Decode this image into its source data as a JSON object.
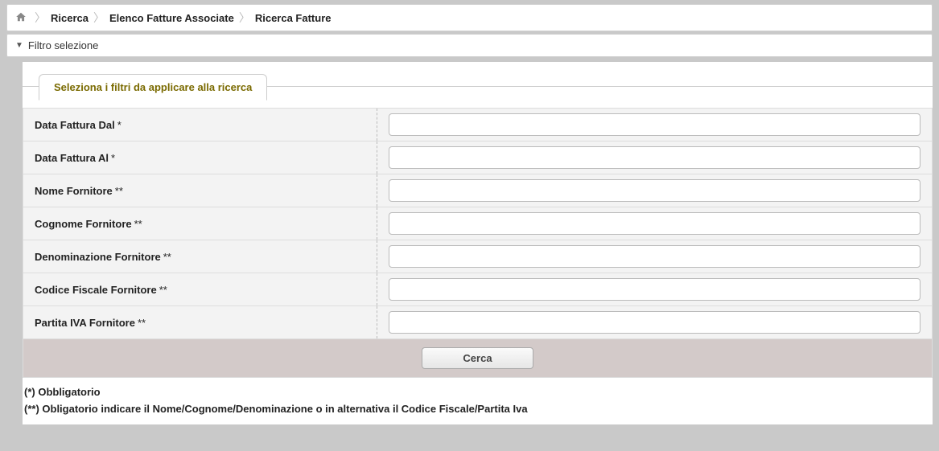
{
  "breadcrumb": {
    "item1": "Ricerca",
    "item2": "Elenco Fatture Associate",
    "item3": "Ricerca Fatture"
  },
  "filter_header": "Filtro selezione",
  "legend": "Seleziona i filtri da applicare alla ricerca",
  "fields": {
    "data_fattura_dal": {
      "label": "Data Fattura Dal",
      "mark": "*",
      "value": ""
    },
    "data_fattura_al": {
      "label": "Data Fattura Al",
      "mark": "*",
      "value": ""
    },
    "nome_fornitore": {
      "label": "Nome Fornitore",
      "mark": "**",
      "value": ""
    },
    "cognome_fornitore": {
      "label": "Cognome Fornitore",
      "mark": "**",
      "value": ""
    },
    "denominazione_fornitore": {
      "label": "Denominazione Fornitore",
      "mark": "**",
      "value": ""
    },
    "codice_fiscale_fornitore": {
      "label": "Codice Fiscale Fornitore",
      "mark": "**",
      "value": ""
    },
    "partita_iva_fornitore": {
      "label": "Partita IVA Fornitore",
      "mark": "**",
      "value": ""
    }
  },
  "search_button": "Cerca",
  "notes": {
    "line1": "(*) Obbligatorio",
    "line2": "(**) Obligatorio indicare il Nome/Cognome/Denominazione o in alternativa il Codice Fiscale/Partita Iva"
  }
}
